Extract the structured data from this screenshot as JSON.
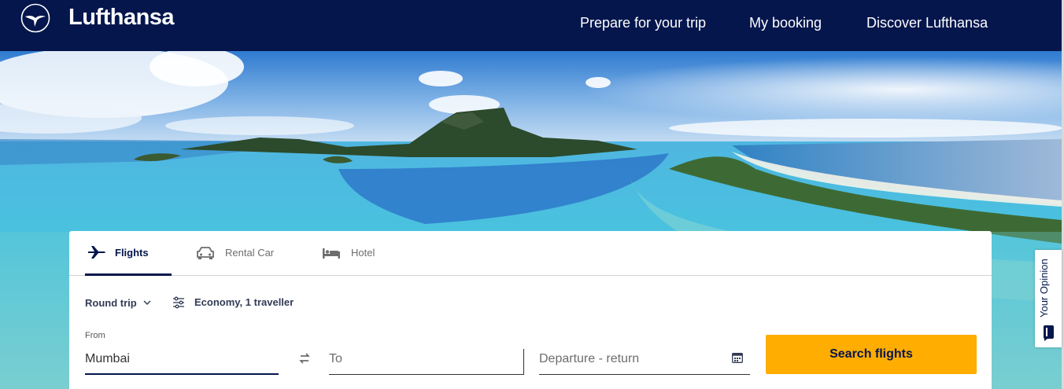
{
  "header": {
    "brand": "Lufthansa",
    "logo_icon": "crane-logo-icon",
    "nav": [
      {
        "label": "Prepare for your trip"
      },
      {
        "label": "My booking"
      },
      {
        "label": "Discover Lufthansa"
      }
    ]
  },
  "hero": {
    "image": "tropical-lagoon-island-photo"
  },
  "feedback": {
    "label": "Your Opinion",
    "icon": "feedback-icon"
  },
  "search": {
    "tabs": [
      {
        "label": "Flights",
        "icon": "airplane-icon",
        "active": true
      },
      {
        "label": "Rental Car",
        "icon": "car-icon",
        "active": false
      },
      {
        "label": "Hotel",
        "icon": "bed-icon",
        "active": false
      }
    ],
    "trip_type": "Round trip",
    "cabin": "Economy, 1 traveller",
    "from_caption": "From",
    "from_value": "Mumbai",
    "to_placeholder": "To",
    "dates_placeholder": "Departure - return",
    "submit_label": "Search flights"
  },
  "colors": {
    "header_bg": "#05164d",
    "accent": "#ffad00",
    "text_dark": "#05164d"
  }
}
